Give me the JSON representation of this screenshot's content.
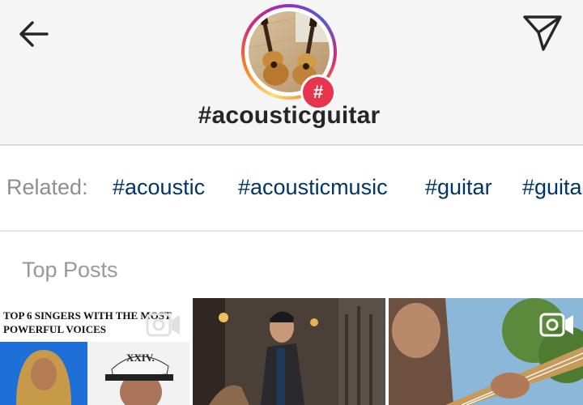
{
  "header": {
    "hashtag": "#acousticguitar",
    "badge_symbol": "#"
  },
  "related": {
    "label": "Related:",
    "tags": [
      "#acoustic",
      "#acousticmusic",
      "#guitar",
      "#guitar"
    ]
  },
  "top_posts": {
    "title": "Top Posts",
    "posts": [
      {
        "caption_line1": "TOP 6 SINGERS WITH THE MOST",
        "caption_line2": "POWERFUL VOICES",
        "cap_text": "XXIV.",
        "has_video": true
      },
      {
        "has_video": false
      },
      {
        "has_video": true
      }
    ]
  },
  "colors": {
    "header_bg": "#f5f5f5",
    "tag_color": "#003569",
    "badge": "#e8344f"
  },
  "icons": [
    "back-arrow-icon",
    "direct-send-icon",
    "hashtag-icon",
    "video-icon"
  ]
}
